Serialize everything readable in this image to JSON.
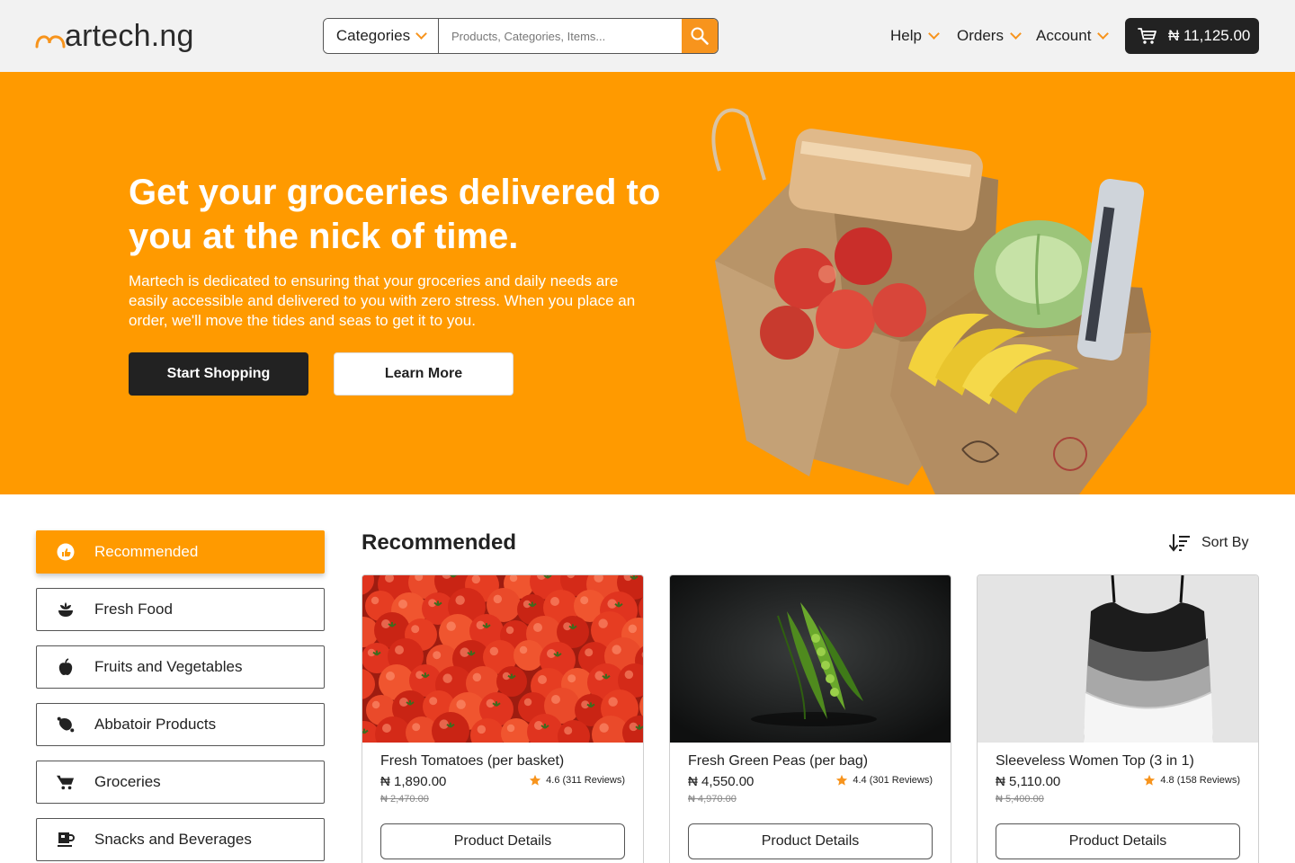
{
  "header": {
    "logo_text": "artech.ng",
    "categories_label": "Categories",
    "search_placeholder": "Products, Categories, Items...",
    "nav": {
      "help": "Help",
      "orders": "Orders",
      "account": "Account"
    },
    "cart_total": "₦ 11,125.00"
  },
  "hero": {
    "title": "Get your groceries delivered to you at the nick of time.",
    "description": "Martech is dedicated to ensuring that your groceries and daily needs are easily accessible and delivered to you with zero stress. When you place an order, we'll move the tides and seas to get it to you.",
    "primary_button": "Start Shopping",
    "secondary_button": "Learn More"
  },
  "sidebar": {
    "items": [
      {
        "label": "Recommended",
        "icon": "recommended-icon",
        "active": true
      },
      {
        "label": "Fresh Food",
        "icon": "fresh-food-icon",
        "active": false
      },
      {
        "label": "Fruits and Vegetables",
        "icon": "apple-icon",
        "active": false
      },
      {
        "label": "Abbatoir Products",
        "icon": "meat-icon",
        "active": false
      },
      {
        "label": "Groceries",
        "icon": "cart-icon",
        "active": false
      },
      {
        "label": "Snacks and Beverages",
        "icon": "cup-icon",
        "active": false
      }
    ]
  },
  "main": {
    "section_title": "Recommended",
    "sort_label": "Sort By",
    "products": [
      {
        "name": "Fresh Tomatoes (per basket)",
        "price": "₦ 1,890.00",
        "old_price": "₦ 2,470.00",
        "rating": "4.6 (311 Reviews)",
        "button": "Product Details",
        "image": "tomatoes"
      },
      {
        "name": "Fresh Green Peas (per bag)",
        "price": "₦ 4,550.00",
        "old_price": "₦ 4,970.00",
        "rating": "4.4 (301 Reviews)",
        "button": "Product Details",
        "image": "green-peas"
      },
      {
        "name": "Sleeveless Women Top (3 in 1)",
        "price": "₦ 5,110.00",
        "old_price": "₦ 5,400.00",
        "rating": "4.8 (158 Reviews)",
        "button": "Product Details",
        "image": "tank-tops"
      }
    ]
  },
  "colors": {
    "accent": "#ff9a00",
    "dark": "#222222",
    "header_bg": "#f2f2f2",
    "star": "#f7941d"
  }
}
